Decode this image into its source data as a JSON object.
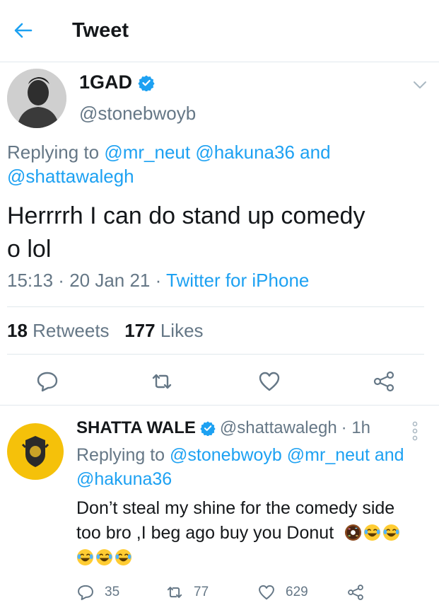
{
  "header": {
    "title": "Tweet"
  },
  "main_tweet": {
    "name": "1GAD",
    "handle": "@stonebwoyb",
    "reply_prefix": "Replying to ",
    "reply_to_1": "@mr_neut",
    "reply_to_2": "@hakuna36",
    "reply_and": " and",
    "reply_to_3": "@shattawalegh",
    "text_line1": "Herrrrh I can do stand up comedy",
    "text_line2": "o lol",
    "time": "15:13",
    "date": "20 Jan 21",
    "sep": " · ",
    "client": "Twitter for iPhone",
    "retweets_count": "18",
    "retweets_label": "Retweets",
    "likes_count": "177",
    "likes_label": "Likes"
  },
  "reply_tweet": {
    "name": "SHATTA WALE",
    "handle": "@shattawalegh",
    "age": "· 1h",
    "reply_prefix": "Replying to ",
    "reply_to_1": "@stonebwoyb",
    "reply_to_2": "@mr_neut",
    "reply_and": " and",
    "reply_to_3": "@hakuna36",
    "text_line1": "Don’t steal my shine for the comedy side",
    "text_line2": "too bro ,I beg ago buy you Donut",
    "reply_count": "35",
    "retweet_count": "77",
    "like_count": "629"
  },
  "colors": {
    "accent": "#1da1f2",
    "secondary": "#657786",
    "divider": "#e1e8ed",
    "avatar_bg": "#f5c10a"
  },
  "icons": [
    "back-arrow-icon",
    "verified-badge-icon",
    "chevron-down-icon",
    "reply-icon",
    "retweet-icon",
    "like-icon",
    "share-icon",
    "more-vertical-icon",
    "donut-emoji",
    "tears-of-joy-emoji"
  ]
}
